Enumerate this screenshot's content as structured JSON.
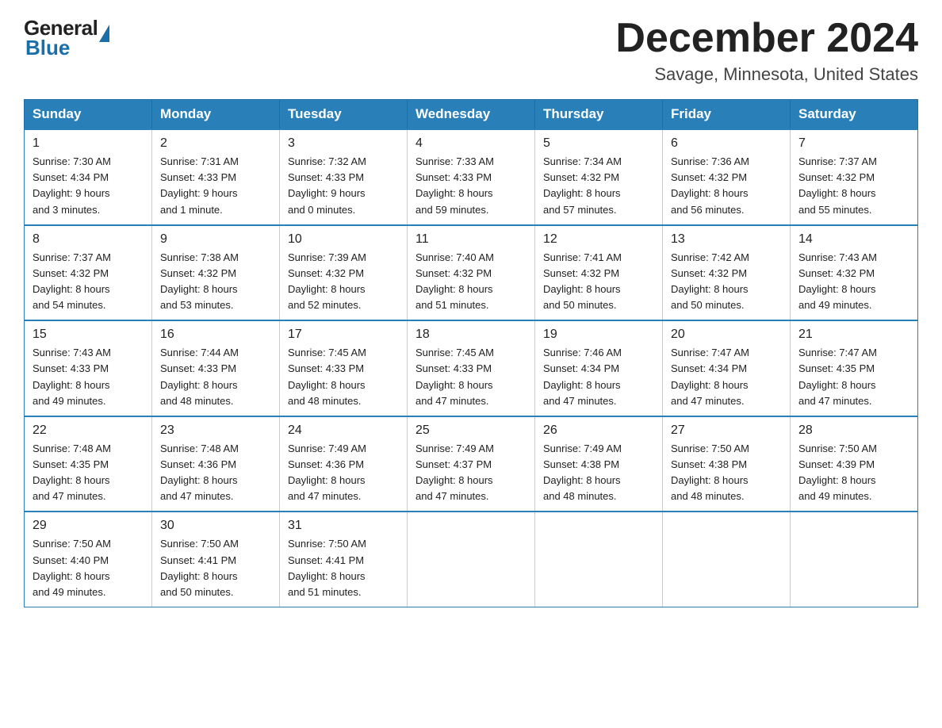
{
  "header": {
    "logo_general": "General",
    "logo_blue": "Blue",
    "title": "December 2024",
    "subtitle": "Savage, Minnesota, United States"
  },
  "days_of_week": [
    "Sunday",
    "Monday",
    "Tuesday",
    "Wednesday",
    "Thursday",
    "Friday",
    "Saturday"
  ],
  "weeks": [
    [
      {
        "day": "1",
        "sunrise": "7:30 AM",
        "sunset": "4:34 PM",
        "daylight": "9 hours and 3 minutes."
      },
      {
        "day": "2",
        "sunrise": "7:31 AM",
        "sunset": "4:33 PM",
        "daylight": "9 hours and 1 minute."
      },
      {
        "day": "3",
        "sunrise": "7:32 AM",
        "sunset": "4:33 PM",
        "daylight": "9 hours and 0 minutes."
      },
      {
        "day": "4",
        "sunrise": "7:33 AM",
        "sunset": "4:33 PM",
        "daylight": "8 hours and 59 minutes."
      },
      {
        "day": "5",
        "sunrise": "7:34 AM",
        "sunset": "4:32 PM",
        "daylight": "8 hours and 57 minutes."
      },
      {
        "day": "6",
        "sunrise": "7:36 AM",
        "sunset": "4:32 PM",
        "daylight": "8 hours and 56 minutes."
      },
      {
        "day": "7",
        "sunrise": "7:37 AM",
        "sunset": "4:32 PM",
        "daylight": "8 hours and 55 minutes."
      }
    ],
    [
      {
        "day": "8",
        "sunrise": "7:37 AM",
        "sunset": "4:32 PM",
        "daylight": "8 hours and 54 minutes."
      },
      {
        "day": "9",
        "sunrise": "7:38 AM",
        "sunset": "4:32 PM",
        "daylight": "8 hours and 53 minutes."
      },
      {
        "day": "10",
        "sunrise": "7:39 AM",
        "sunset": "4:32 PM",
        "daylight": "8 hours and 52 minutes."
      },
      {
        "day": "11",
        "sunrise": "7:40 AM",
        "sunset": "4:32 PM",
        "daylight": "8 hours and 51 minutes."
      },
      {
        "day": "12",
        "sunrise": "7:41 AM",
        "sunset": "4:32 PM",
        "daylight": "8 hours and 50 minutes."
      },
      {
        "day": "13",
        "sunrise": "7:42 AM",
        "sunset": "4:32 PM",
        "daylight": "8 hours and 50 minutes."
      },
      {
        "day": "14",
        "sunrise": "7:43 AM",
        "sunset": "4:32 PM",
        "daylight": "8 hours and 49 minutes."
      }
    ],
    [
      {
        "day": "15",
        "sunrise": "7:43 AM",
        "sunset": "4:33 PM",
        "daylight": "8 hours and 49 minutes."
      },
      {
        "day": "16",
        "sunrise": "7:44 AM",
        "sunset": "4:33 PM",
        "daylight": "8 hours and 48 minutes."
      },
      {
        "day": "17",
        "sunrise": "7:45 AM",
        "sunset": "4:33 PM",
        "daylight": "8 hours and 48 minutes."
      },
      {
        "day": "18",
        "sunrise": "7:45 AM",
        "sunset": "4:33 PM",
        "daylight": "8 hours and 47 minutes."
      },
      {
        "day": "19",
        "sunrise": "7:46 AM",
        "sunset": "4:34 PM",
        "daylight": "8 hours and 47 minutes."
      },
      {
        "day": "20",
        "sunrise": "7:47 AM",
        "sunset": "4:34 PM",
        "daylight": "8 hours and 47 minutes."
      },
      {
        "day": "21",
        "sunrise": "7:47 AM",
        "sunset": "4:35 PM",
        "daylight": "8 hours and 47 minutes."
      }
    ],
    [
      {
        "day": "22",
        "sunrise": "7:48 AM",
        "sunset": "4:35 PM",
        "daylight": "8 hours and 47 minutes."
      },
      {
        "day": "23",
        "sunrise": "7:48 AM",
        "sunset": "4:36 PM",
        "daylight": "8 hours and 47 minutes."
      },
      {
        "day": "24",
        "sunrise": "7:49 AM",
        "sunset": "4:36 PM",
        "daylight": "8 hours and 47 minutes."
      },
      {
        "day": "25",
        "sunrise": "7:49 AM",
        "sunset": "4:37 PM",
        "daylight": "8 hours and 47 minutes."
      },
      {
        "day": "26",
        "sunrise": "7:49 AM",
        "sunset": "4:38 PM",
        "daylight": "8 hours and 48 minutes."
      },
      {
        "day": "27",
        "sunrise": "7:50 AM",
        "sunset": "4:38 PM",
        "daylight": "8 hours and 48 minutes."
      },
      {
        "day": "28",
        "sunrise": "7:50 AM",
        "sunset": "4:39 PM",
        "daylight": "8 hours and 49 minutes."
      }
    ],
    [
      {
        "day": "29",
        "sunrise": "7:50 AM",
        "sunset": "4:40 PM",
        "daylight": "8 hours and 49 minutes."
      },
      {
        "day": "30",
        "sunrise": "7:50 AM",
        "sunset": "4:41 PM",
        "daylight": "8 hours and 50 minutes."
      },
      {
        "day": "31",
        "sunrise": "7:50 AM",
        "sunset": "4:41 PM",
        "daylight": "8 hours and 51 minutes."
      },
      null,
      null,
      null,
      null
    ]
  ],
  "labels": {
    "sunrise": "Sunrise:",
    "sunset": "Sunset:",
    "daylight": "Daylight:"
  }
}
